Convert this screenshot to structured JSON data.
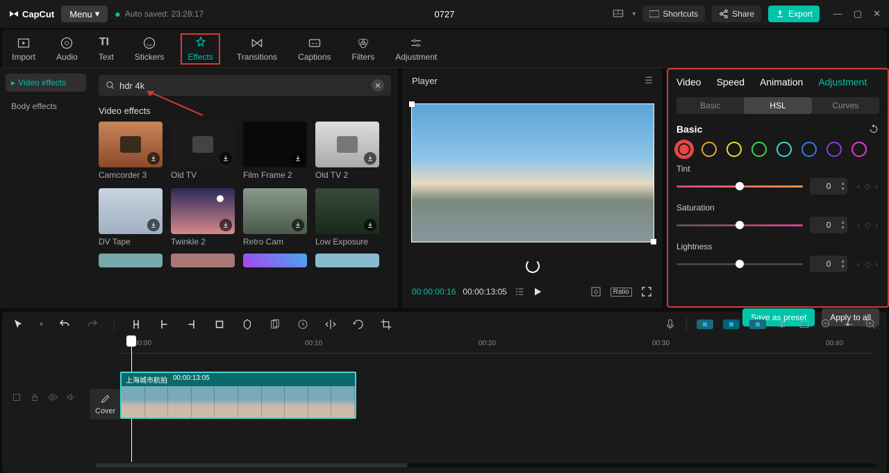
{
  "titlebar": {
    "app_name": "CapCut",
    "menu": "Menu",
    "autosave_label": "Auto saved: 23:28:17",
    "project_name": "0727",
    "shortcuts": "Shortcuts",
    "share": "Share",
    "export": "Export"
  },
  "tooltabs": {
    "import": "Import",
    "audio": "Audio",
    "text": "Text",
    "stickers": "Stickers",
    "effects": "Effects",
    "transitions": "Transitions",
    "captions": "Captions",
    "filters": "Filters",
    "adjustment": "Adjustment"
  },
  "sidebar": {
    "video_effects": "Video effects",
    "body_effects": "Body effects"
  },
  "search": {
    "value": "hdr 4k"
  },
  "effects": {
    "section": "Video effects",
    "items": [
      {
        "label": "Camcorder 3"
      },
      {
        "label": "Old TV"
      },
      {
        "label": "Film Frame 2"
      },
      {
        "label": "Old TV 2"
      },
      {
        "label": "DV Tape"
      },
      {
        "label": "Twinkle 2"
      },
      {
        "label": "Retro Cam"
      },
      {
        "label": "Low Exposure"
      }
    ]
  },
  "player": {
    "title": "Player",
    "time_current": "00:00:00:16",
    "time_duration": "00:00:13:05",
    "ratio": "Ratio"
  },
  "panel": {
    "tabs": {
      "video": "Video",
      "speed": "Speed",
      "animation": "Animation",
      "adjustment": "Adjustment"
    },
    "subtabs": {
      "basic": "Basic",
      "hsl": "HSL",
      "curves": "Curves"
    },
    "group": "Basic",
    "colors": [
      "#e54848",
      "#e8a23a",
      "#e8e23a",
      "#3ad84a",
      "#3ad8d8",
      "#3a7ae8",
      "#8a3ae8",
      "#e83ad8"
    ],
    "sliders": {
      "tint": {
        "label": "Tint",
        "value": "0"
      },
      "saturation": {
        "label": "Saturation",
        "value": "0"
      },
      "lightness": {
        "label": "Lightness",
        "value": "0"
      }
    },
    "save_preset": "Save as preset",
    "apply_all": "Apply to all"
  },
  "timeline": {
    "marks": [
      "00:00",
      "00:10",
      "00:20",
      "00:30",
      "00:40"
    ],
    "clip_name": "上海城市航拍",
    "clip_dur": "00:00:13:05",
    "cover": "Cover"
  }
}
